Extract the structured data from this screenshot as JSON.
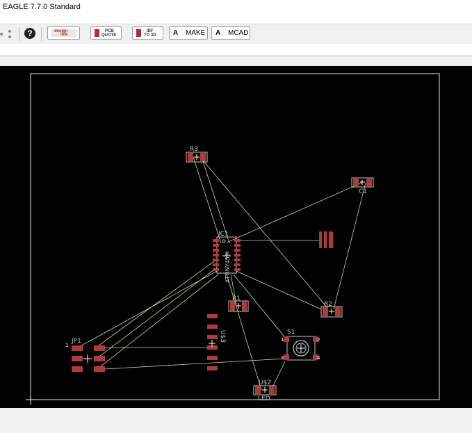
{
  "app": {
    "title": "EAGLE 7.7.0 Standard"
  },
  "toolbar": {
    "help_glyph": "?",
    "design_link": {
      "top": "design",
      "bottom": "link"
    },
    "pcb_quote": {
      "top": "PCB",
      "bottom": "QUOTE"
    },
    "idf_to_3d": {
      "top": "IDF",
      "bottom": "TO 3D"
    },
    "make_label": "MAKE",
    "mcad_label": "MCAD",
    "brand_glyph": "A"
  },
  "board": {
    "parts": {
      "r3": "R3",
      "c1": "C1",
      "ic1": "IC1",
      "ic1_value": "ATTINY45SI",
      "r1": "R1",
      "r2": "R2",
      "s1": "S1",
      "u3": "U$3",
      "u2": "U$2",
      "led": "LED",
      "jp1": "JP1"
    },
    "pins": {
      "jp1_pin1": "1",
      "s1_pin1": "1",
      "s1_pin2": "2",
      "s1_pin3": "3",
      "s1_pin4": "4"
    }
  },
  "colors": {
    "background": "#000000",
    "pad": "#b03a3a",
    "airwire": "#d8d890",
    "outline": "#e8e8e8",
    "silk": "#c8c8c8"
  }
}
